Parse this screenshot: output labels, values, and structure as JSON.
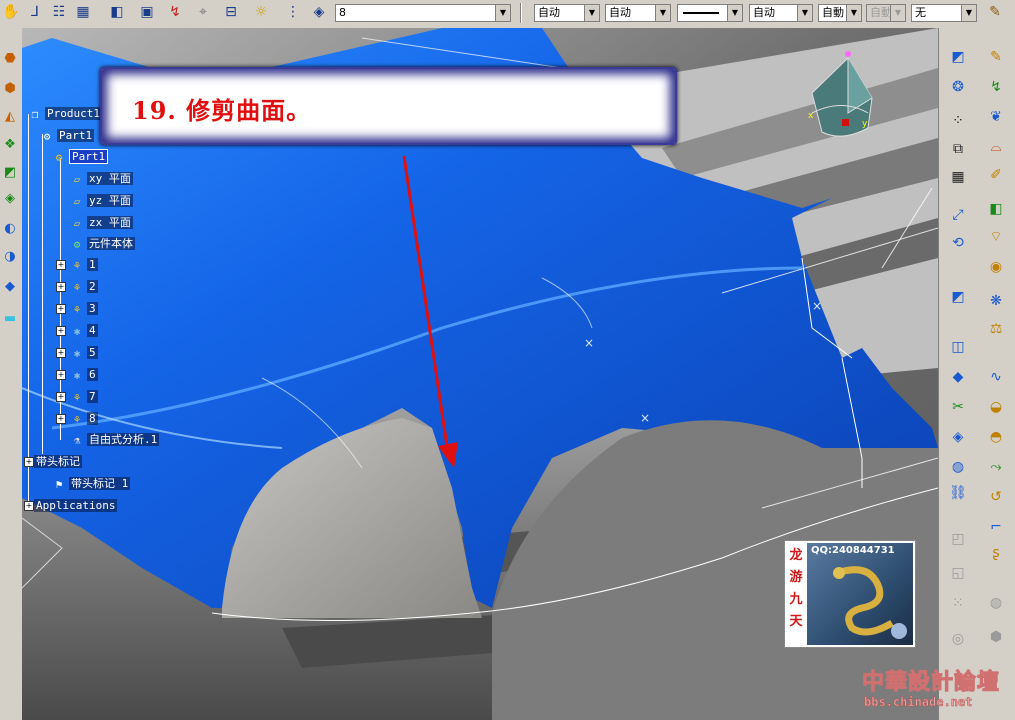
{
  "toolbar": {
    "icons": [
      "hand-icon",
      "axis-icon",
      "tree-icon",
      "grid-icon",
      "cube-icon",
      "box-icon",
      "arrow-x-icon",
      "dimension-icon",
      "align-icon",
      "snap-icon",
      "layer-icon",
      "edit-icon"
    ],
    "layer_value": "8",
    "linetype_value": "自动",
    "linetype2_value": "自动",
    "weight_value": "自动",
    "font_value": "自動",
    "disabled_value": "自動",
    "fill_value": "无"
  },
  "caption": {
    "text": "19. 修剪曲面。"
  },
  "tree": {
    "product": "Product1",
    "part_root": "Part1",
    "part": "Part1",
    "xy_plane": "xy 平面",
    "yz_plane": "yz 平面",
    "zx_plane": "zx 平面",
    "body": "元件本体",
    "items": [
      "1",
      "2",
      "3",
      "4",
      "5",
      "6",
      "7",
      "8"
    ],
    "analysis": "自由式分析.1",
    "annotation_group": "带头标记",
    "annotation_item": "带头标记 1",
    "applications": "Applications"
  },
  "logo": {
    "qq": "QQ:240844731",
    "dragon_chars": [
      "龙",
      "游",
      "九",
      "天"
    ],
    "forum_title": "中華設計論壇",
    "forum_url": "bbs.chinade.net"
  },
  "colors": {
    "surface": "#1565e8",
    "caption_text": "#e01010",
    "background_metal": "#8c8c8c"
  }
}
